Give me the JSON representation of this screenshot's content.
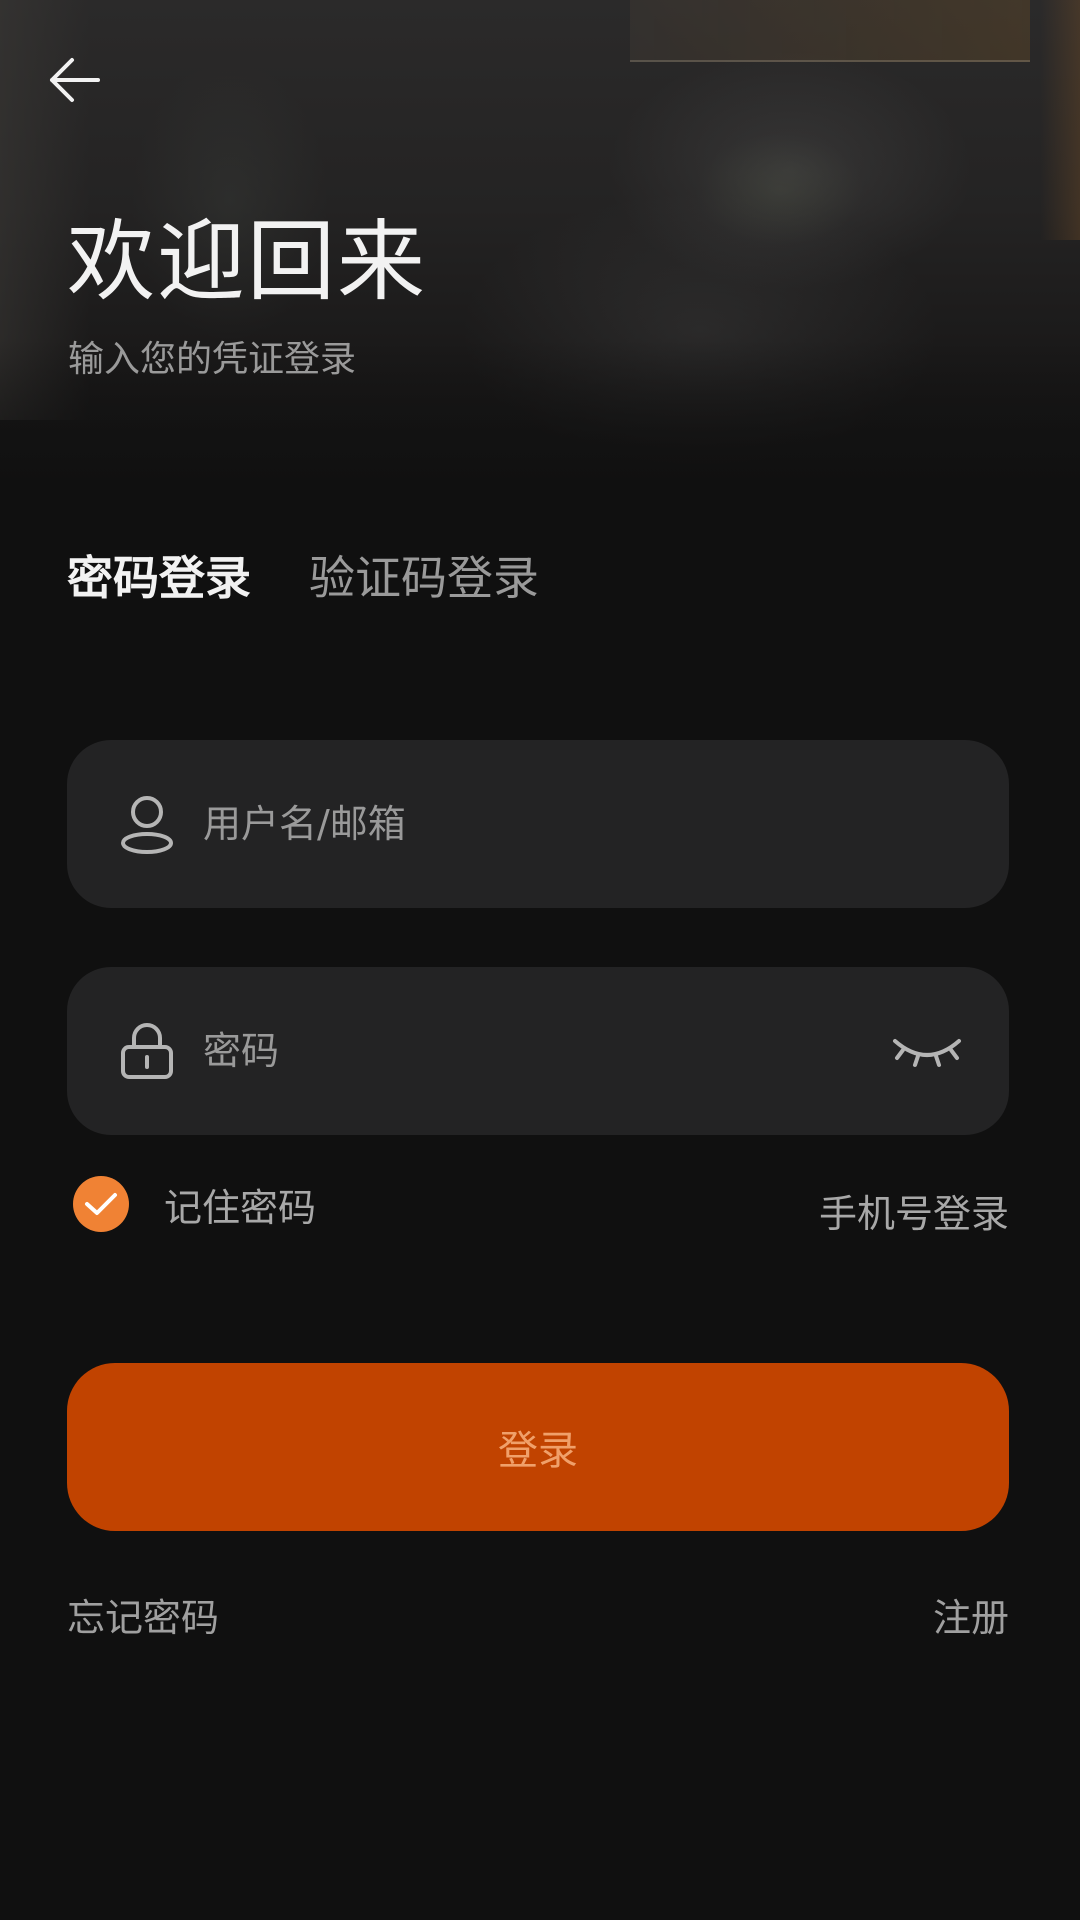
{
  "header": {
    "title": "欢迎回来",
    "subtitle": "输入您的凭证登录"
  },
  "tabs": [
    {
      "label": "密码登录",
      "active": true
    },
    {
      "label": "验证码登录",
      "active": false
    }
  ],
  "username_field": {
    "placeholder": "用户名/邮箱",
    "value": "",
    "icon": "user-icon"
  },
  "password_field": {
    "placeholder": "密码",
    "value": "",
    "icon": "lock-icon",
    "toggle_icon": "eye-closed-icon"
  },
  "remember": {
    "label": "记住密码",
    "checked": true
  },
  "phone_login_label": "手机号登录",
  "login_button_label": "登录",
  "forgot_password_label": "忘记密码",
  "register_label": "注册",
  "colors": {
    "background": "#101010",
    "field_bg": "#232324",
    "accent": "#c14300",
    "checkbox": "#f08234",
    "primary_text": "#f2f2f2",
    "secondary_text": "#9a9a9a"
  }
}
